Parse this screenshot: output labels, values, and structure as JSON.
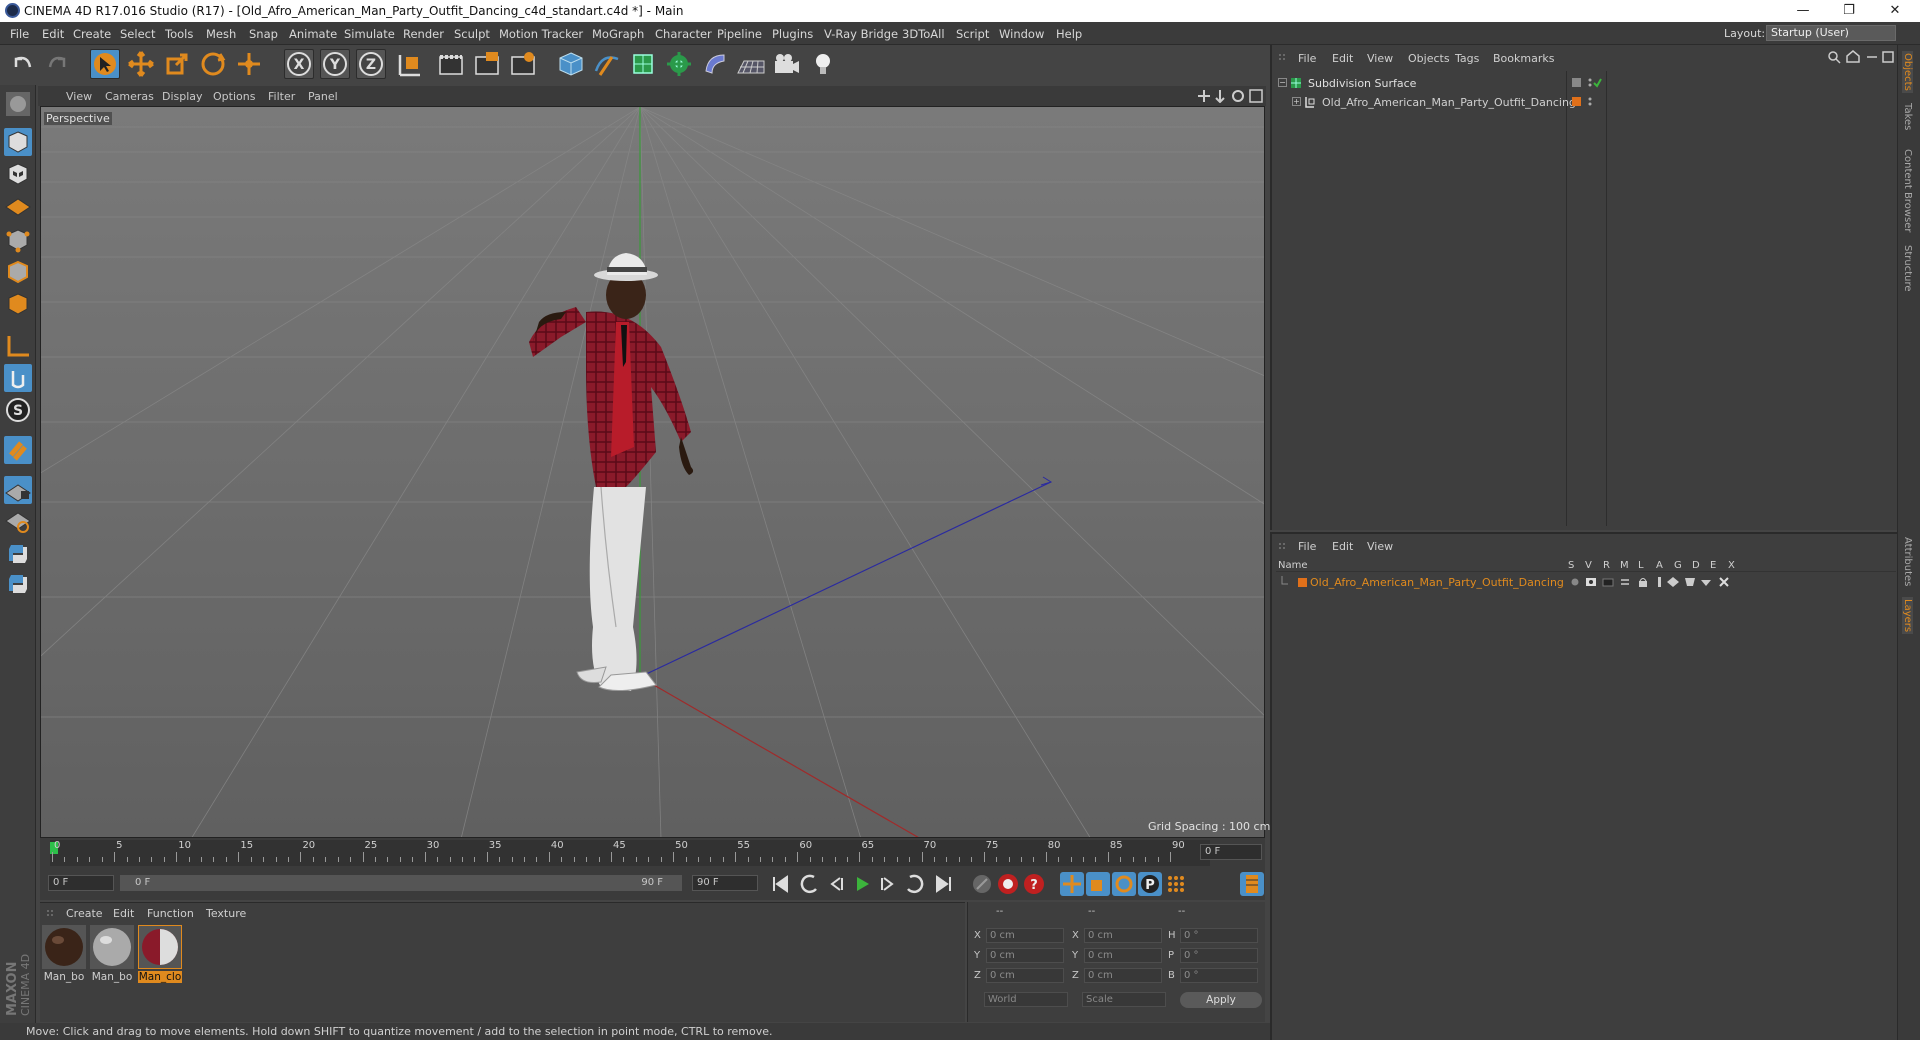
{
  "window": {
    "title": "CINEMA 4D R17.016 Studio (R17) - [Old_Afro_American_Man_Party_Outfit_Dancing_c4d_standart.c4d *] - Main",
    "minimize": "—",
    "restore": "❐",
    "close": "✕"
  },
  "menubar": {
    "items": [
      "File",
      "Edit",
      "Create",
      "Select",
      "Tools",
      "Mesh",
      "Snap",
      "Animate",
      "Simulate",
      "Render",
      "Sculpt",
      "Motion Tracker",
      "MoGraph",
      "Character",
      "Pipeline",
      "Plugins",
      "V-Ray Bridge",
      "3DToAll",
      "Script",
      "Window",
      "Help"
    ],
    "layout_label": "Layout:",
    "layout_value": "Startup (User)"
  },
  "toolbar": {
    "icons": [
      "undo-icon",
      "redo-icon",
      "select-arrow-icon",
      "move-icon",
      "scale-icon",
      "rotate-icon",
      "live-select-icon",
      "x-axis-icon",
      "y-axis-icon",
      "z-axis-icon",
      "coordinate-system-icon",
      "render-view-icon",
      "render-picture-viewer-icon",
      "render-settings-icon",
      "cube-primitive-icon",
      "pen-spline-icon",
      "subdivision-icon",
      "cloner-icon",
      "deformer-icon",
      "floor-icon",
      "camera-icon",
      "light-icon"
    ],
    "axis_x": "X",
    "axis_y": "Y",
    "axis_z": "Z"
  },
  "viewport": {
    "menu": [
      "View",
      "Cameras",
      "Display",
      "Options",
      "Filter",
      "Panel"
    ],
    "label": "Perspective",
    "grid_spacing": "Grid Spacing : 100 cm"
  },
  "timeline": {
    "ticks": [
      "0",
      "5",
      "10",
      "15",
      "20",
      "25",
      "30",
      "35",
      "40",
      "45",
      "50",
      "55",
      "60",
      "65",
      "70",
      "75",
      "80",
      "85",
      "90"
    ],
    "current_frame": "0 F",
    "start_field": "0 F",
    "range_start": "0 F",
    "range_end": "90 F",
    "end_field": "90 F"
  },
  "material_panel": {
    "menu": [
      "Create",
      "Edit",
      "Function",
      "Texture"
    ],
    "materials": [
      {
        "label": "Man_bo"
      },
      {
        "label": "Man_bo"
      },
      {
        "label": "Man_clo"
      }
    ]
  },
  "coord_panel": {
    "header": [
      "--",
      "--",
      "--"
    ],
    "rows": [
      {
        "a": "X",
        "av": "0 cm",
        "b": "X",
        "bv": "0 cm",
        "c": "H",
        "cv": "0 °"
      },
      {
        "a": "Y",
        "av": "0 cm",
        "b": "Y",
        "bv": "0 cm",
        "c": "P",
        "cv": "0 °"
      },
      {
        "a": "Z",
        "av": "0 cm",
        "b": "Z",
        "bv": "0 cm",
        "c": "B",
        "cv": "0 °"
      }
    ],
    "world": "World",
    "scale": "Scale",
    "apply": "Apply"
  },
  "object_manager": {
    "menu": [
      "File",
      "Edit",
      "View",
      "Objects",
      "Tags",
      "Bookmarks"
    ],
    "objects": [
      {
        "name": "Subdivision Surface"
      },
      {
        "name": "Old_Afro_American_Man_Party_Outfit_Dancing"
      }
    ]
  },
  "layer_manager": {
    "menu": [
      "File",
      "Edit",
      "View"
    ],
    "columns": [
      "Name",
      "S",
      "V",
      "R",
      "M",
      "L",
      "A",
      "G",
      "D",
      "E",
      "X"
    ],
    "layers": [
      {
        "name": "Old_Afro_American_Man_Party_Outfit_Dancing",
        "color": "#e0701a"
      }
    ]
  },
  "right_tabs": [
    "Objects",
    "Takes",
    "Content Browser",
    "Structure",
    "Attributes",
    "Layers"
  ],
  "status": "Move: Click and drag to move elements. Hold down SHIFT to quantize movement / add to the selection in point mode, CTRL to remove.",
  "colors": {
    "accent_orange": "#e08a1e",
    "layer_orange": "#e0701a",
    "active_blue": "#4a90c8",
    "play_green": "#3cb43c"
  }
}
